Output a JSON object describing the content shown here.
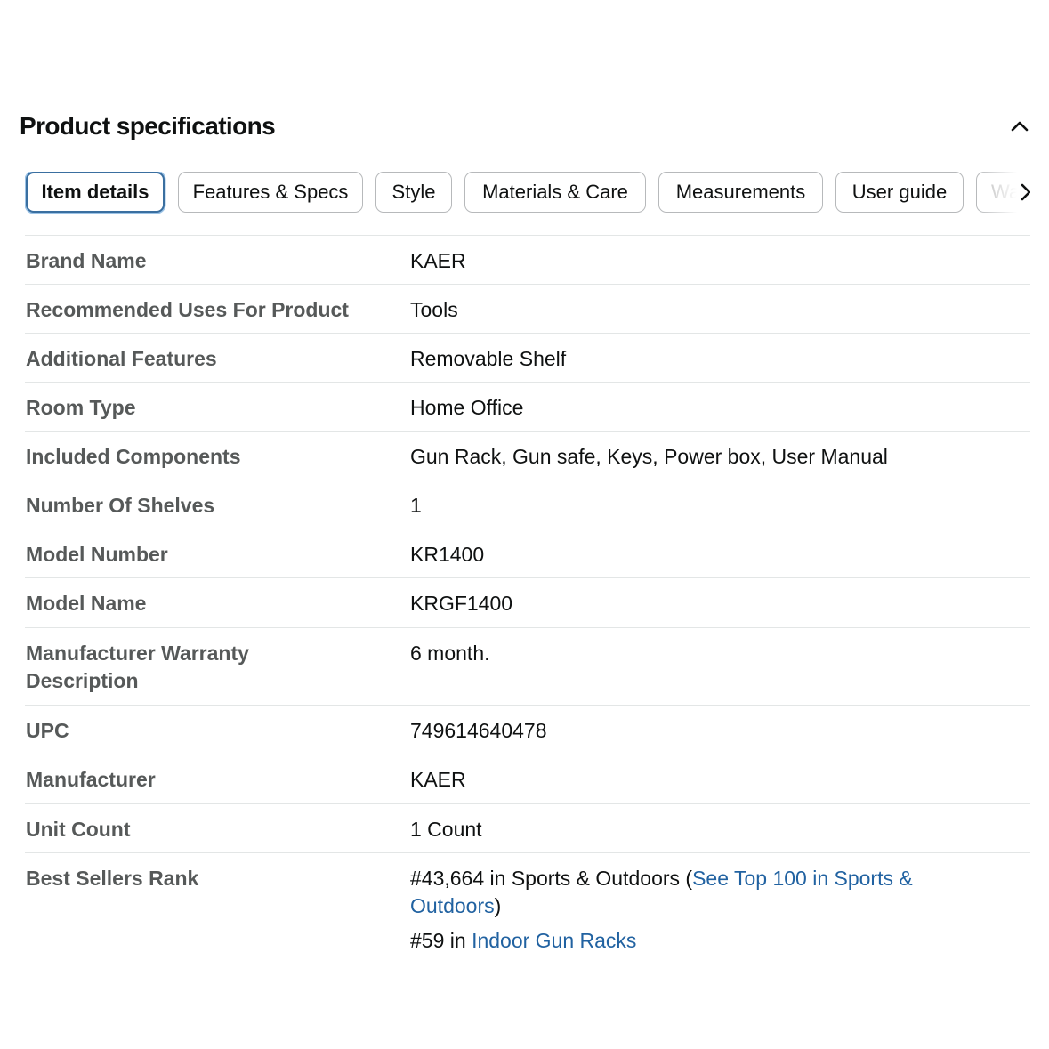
{
  "header": {
    "title": "Product specifications",
    "collapse_icon": "chevron-up-icon"
  },
  "tabs": [
    {
      "label": "Item details",
      "active": true
    },
    {
      "label": "Features & Specs"
    },
    {
      "label": "Style"
    },
    {
      "label": "Materials & Care"
    },
    {
      "label": "Measurements"
    },
    {
      "label": "User guide"
    },
    {
      "label": "Wa"
    }
  ],
  "tabs_scroll_icon": "chevron-right-icon",
  "specs": [
    {
      "key": "Brand Name",
      "value": "KAER"
    },
    {
      "key": "Recommended Uses For Product",
      "value": "Tools"
    },
    {
      "key": "Additional Features",
      "value": "Removable Shelf"
    },
    {
      "key": "Room Type",
      "value": "Home Office"
    },
    {
      "key": "Included Components",
      "value": "Gun Rack, Gun safe, Keys, Power box, User Manual"
    },
    {
      "key": "Number Of Shelves",
      "value": "1"
    },
    {
      "key": "Model Number",
      "value": "KR1400"
    },
    {
      "key": "Model Name",
      "value": "KRGF1400"
    },
    {
      "key": "Manufacturer Warranty Description",
      "value": "6 month."
    },
    {
      "key": "UPC",
      "value": "749614640478"
    },
    {
      "key": "Manufacturer",
      "value": "KAER"
    },
    {
      "key": "Unit Count",
      "value": "1 Count"
    },
    {
      "key": "Best Sellers Rank"
    }
  ],
  "best_sellers": {
    "rank1_prefix": "#43,664 in Sports & Outdoors (",
    "rank1_link": "See Top 100 in Sports & Outdoors",
    "rank1_suffix": ")",
    "rank2_prefix": "#59 in ",
    "rank2_link": "Indoor Gun Racks"
  },
  "colors": {
    "link": "#2162a1",
    "active_tab_border": "#3a6fa0",
    "key_text": "#565959",
    "divider": "#e3e6e6"
  }
}
